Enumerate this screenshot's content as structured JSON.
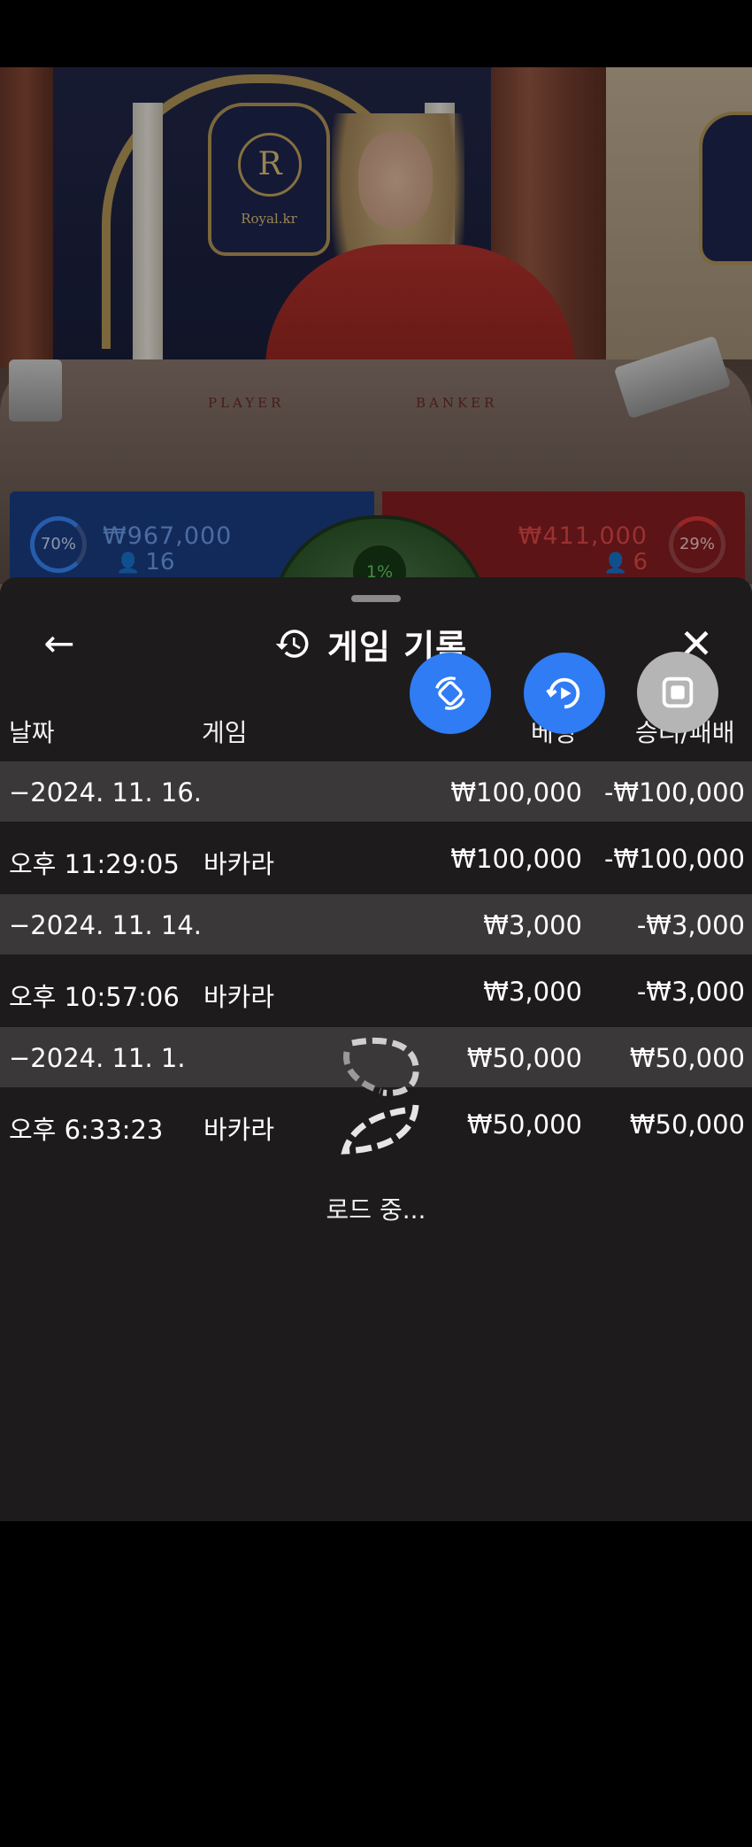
{
  "stream": {
    "brand": "Royal.kr",
    "crest_letter": "R",
    "table_labels": {
      "player": "PLAYER",
      "banker": "BANKER"
    }
  },
  "betting": {
    "player": {
      "percent": "70%",
      "amount": "₩967,000",
      "players": "16"
    },
    "banker": {
      "percent": "29%",
      "amount": "₩411,000",
      "players": "6"
    },
    "tie": {
      "percent": "1%"
    }
  },
  "sheet": {
    "title": "게임 기록",
    "icons": {
      "back": "arrow-left-icon",
      "history": "history-icon",
      "close": "close-icon"
    }
  },
  "floating_buttons": [
    {
      "name": "rotate-screen-icon",
      "color": "#2f7cf5"
    },
    {
      "name": "replay-icon",
      "color": "#2f7cf5"
    },
    {
      "name": "stop-icon",
      "color": "#b5b5b5"
    }
  ],
  "columns": {
    "date": "날짜",
    "game": "게임",
    "bet": "베팅",
    "result": "승리/패배"
  },
  "history": [
    {
      "type": "date",
      "label": "−2024. 11. 16.",
      "bet": "₩100,000",
      "result": "-₩100,000"
    },
    {
      "type": "item",
      "time": "오후 11:29:05",
      "game": "바카라",
      "bet": "₩100,000",
      "result": "-₩100,000"
    },
    {
      "type": "date",
      "label": "−2024. 11. 14.",
      "bet": "₩3,000",
      "result": "-₩3,000"
    },
    {
      "type": "item",
      "time": "오후 10:57:06",
      "game": "바카라",
      "bet": "₩3,000",
      "result": "-₩3,000"
    },
    {
      "type": "date",
      "label": "−2024. 11. 1.",
      "bet": "₩50,000",
      "result": "₩50,000"
    },
    {
      "type": "item",
      "time": "오후 6:33:23",
      "game": "바카라",
      "bet": "₩50,000",
      "result": "₩50,000"
    }
  ],
  "loading_text": "로드 중..."
}
